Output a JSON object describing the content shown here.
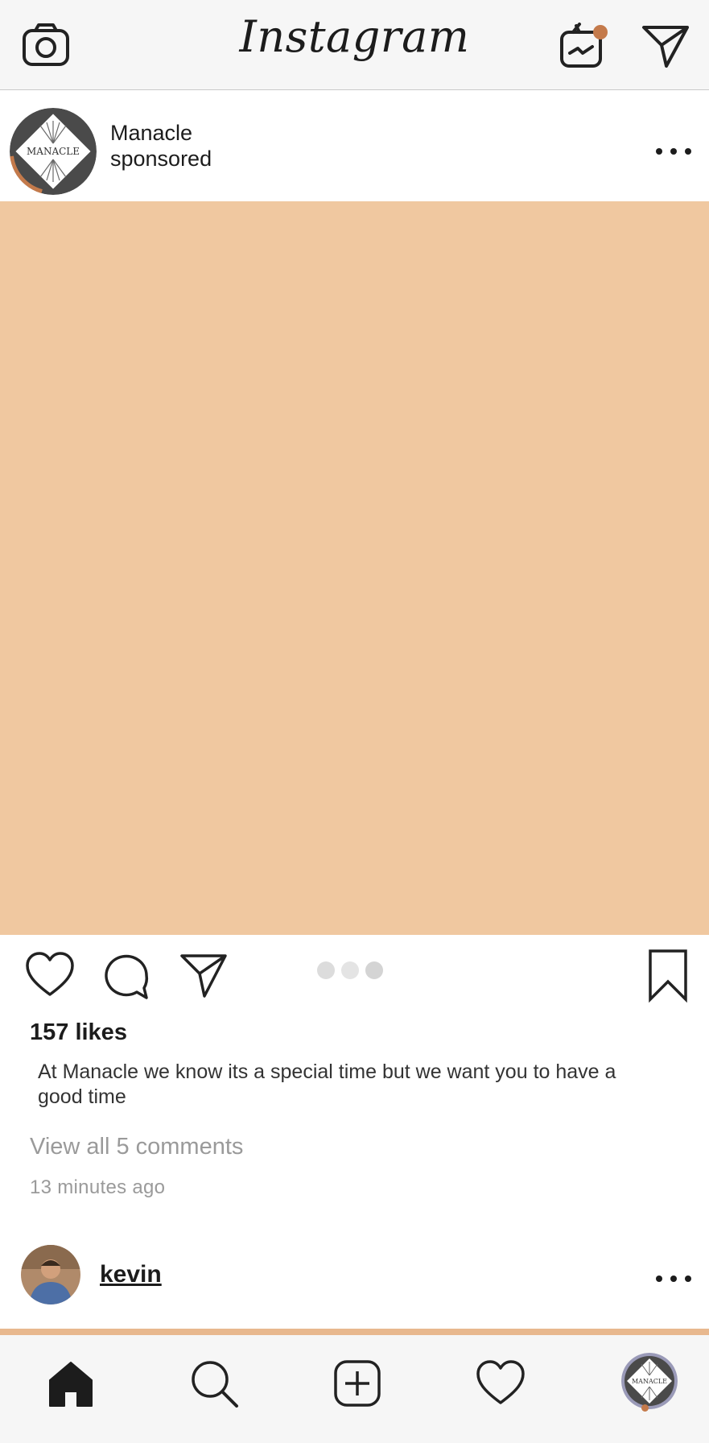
{
  "app": {
    "brand_name": "Instagram",
    "accent_color": "#c47a4b"
  },
  "header": {
    "camera_icon": "camera-icon",
    "igtv_icon": "igtv-icon",
    "direct_icon": "paper-plane-icon",
    "notification_dot_color": "#c47a4b"
  },
  "post": {
    "account_name": "Manacle",
    "account_subtitle": "sponsored",
    "avatar_logo_text": "MANACLE",
    "media_color": "#f0c8a0",
    "carousel_count": 3,
    "likes": "157 likes",
    "caption": "At Manacle we know its a special time but we want you to have a good time",
    "view_comments": "View all 5 comments",
    "timestamp": "13 minutes ago"
  },
  "next_post": {
    "account_name": "kevin"
  },
  "bottom_nav": {
    "items": [
      "home-icon",
      "search-icon",
      "add-post-icon",
      "heart-icon",
      "profile-avatar"
    ],
    "profile_logo_text": "MANACLE"
  }
}
